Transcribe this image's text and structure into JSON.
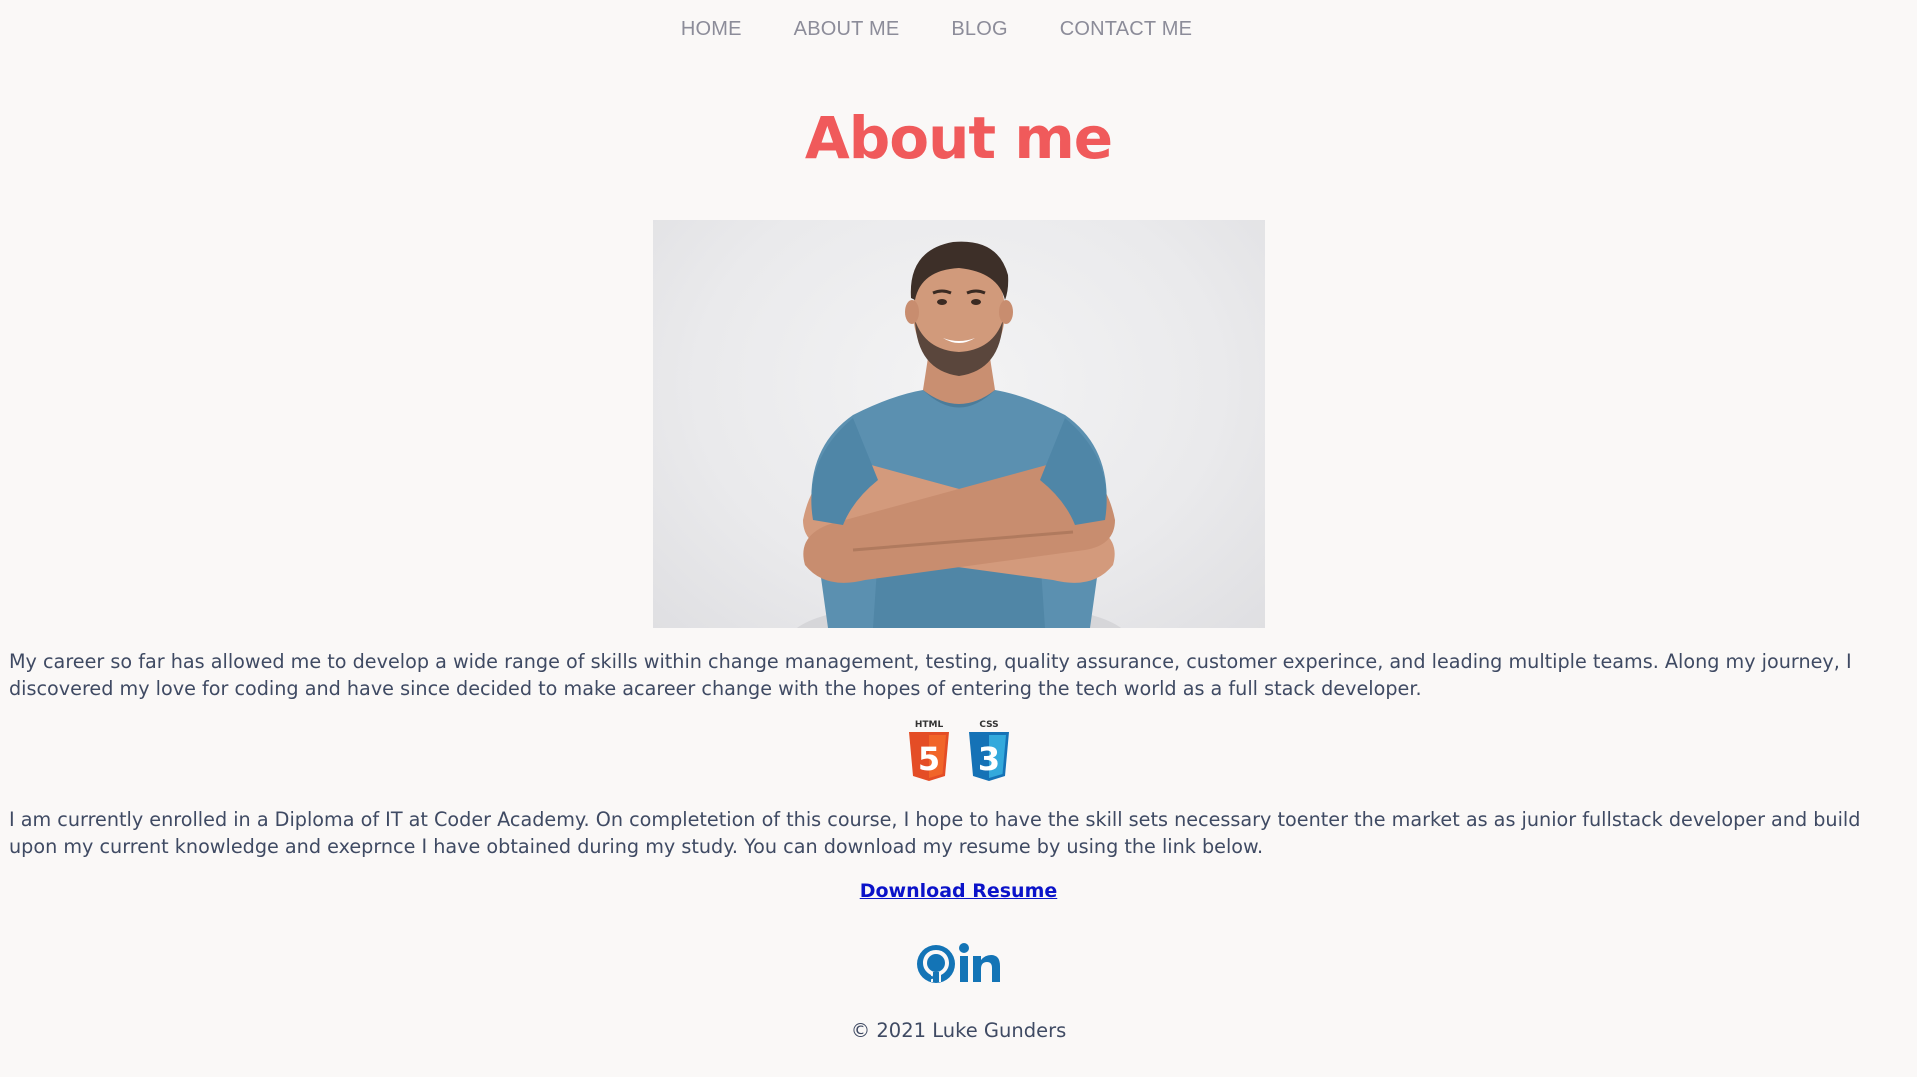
{
  "nav": {
    "items": [
      {
        "label": "HOME"
      },
      {
        "label": "ABOUT ME"
      },
      {
        "label": "BLOG"
      },
      {
        "label": "CONTACT ME"
      }
    ]
  },
  "page": {
    "title": "About me"
  },
  "profile_photo": {
    "alt": "portrait-photo"
  },
  "content": {
    "paragraph1": "My career so far has allowed me to develop a wide range of skills within change management, testing, quality assurance, customer experince, and leading multiple teams. Along my journey, I discovered my love for coding and have since decided to make acareer change with the hopes of entering the tech world as a full stack developer.",
    "paragraph2": "I am currently enrolled in a Diploma of IT at Coder Academy. On completetion of this course, I hope to have the skill sets necessary toenter the market as as junior fullstack developer and build upon my current knowledge and exeprnce I have obtained during my study. You can download my resume by using the link below."
  },
  "skills": [
    {
      "label": "HTML",
      "digit": "5",
      "icon": "html5-icon",
      "color": "#e44d26",
      "shade": "#f16529"
    },
    {
      "label": "CSS",
      "digit": "3",
      "icon": "css3-icon",
      "color": "#1572b6",
      "shade": "#33a9dc"
    }
  ],
  "download": {
    "label": "Download Resume"
  },
  "social": [
    {
      "icon": "github-icon"
    },
    {
      "icon": "linkedin-icon"
    }
  ],
  "colors": {
    "accent": "#f05a5b",
    "text": "#3f4a63",
    "nav": "#8c8c99",
    "link": "#0b13c9",
    "background": "#faf8f7",
    "social": "#1374b6"
  },
  "footer": {
    "text": "© 2021 Luke Gunders"
  }
}
